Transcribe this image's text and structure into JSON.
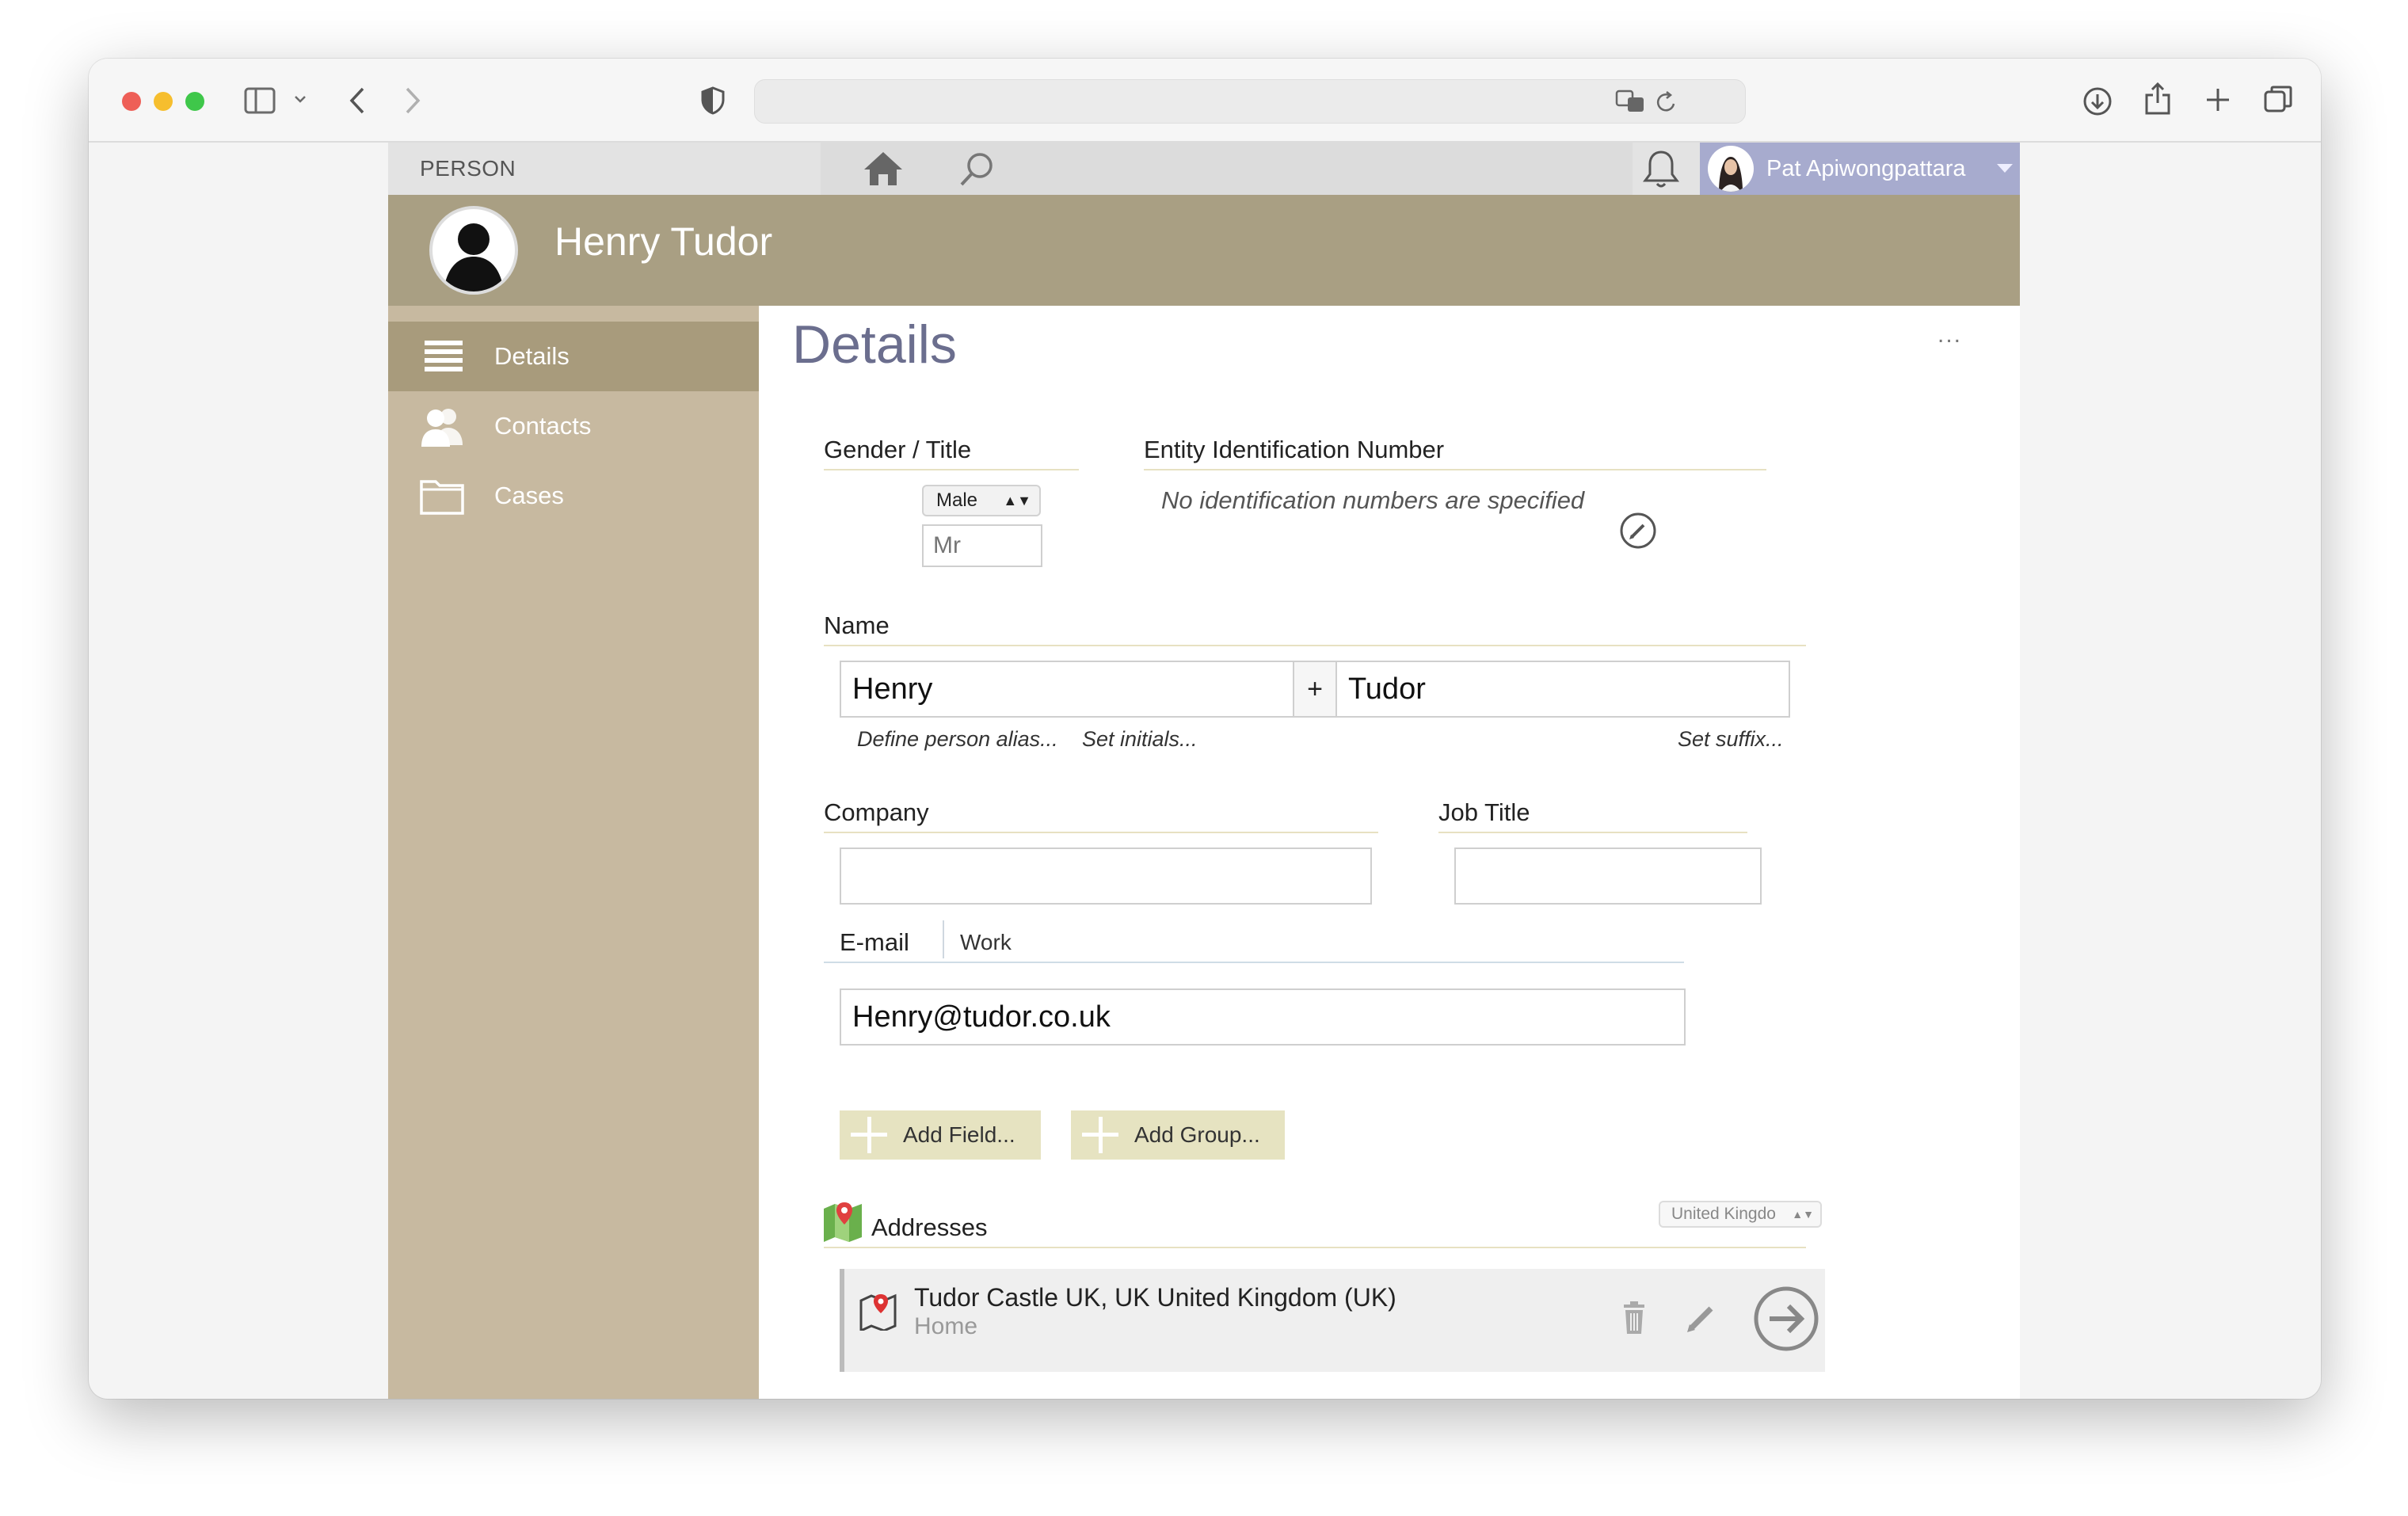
{
  "browser": {
    "traffic_lights": {
      "close": "#ee5f57",
      "minimize": "#f6be2e",
      "zoom": "#3fc74a"
    }
  },
  "topnav": {
    "module_label": "PERSON",
    "user_name": "Pat Apiwongpattara"
  },
  "header": {
    "person_name": "Henry Tudor"
  },
  "sidebar": {
    "items": [
      {
        "label": "Details",
        "icon": "list-icon",
        "active": true
      },
      {
        "label": "Contacts",
        "icon": "contacts-icon",
        "active": false
      },
      {
        "label": "Cases",
        "icon": "folder-icon",
        "active": false
      }
    ]
  },
  "details": {
    "title": "Details",
    "more": "...",
    "gender_title": {
      "label": "Gender / Title",
      "gender_value": "Male",
      "title_placeholder": "Mr"
    },
    "entity_id": {
      "label": "Entity Identification Number",
      "empty_text": "No identification numbers are specified"
    },
    "name": {
      "label": "Name",
      "first": "Henry",
      "plus": "+",
      "last": "Tudor",
      "alias_link": "Define person alias...",
      "initials_link": "Set initials...",
      "suffix_link": "Set suffix..."
    },
    "company": {
      "label": "Company",
      "value": ""
    },
    "job_title": {
      "label": "Job Title",
      "value": ""
    },
    "email": {
      "label": "E-mail",
      "type": "Work",
      "value": "Henry@tudor.co.uk"
    },
    "buttons": {
      "add_field": "Add Field...",
      "add_group": "Add Group..."
    },
    "addresses": {
      "label": "Addresses",
      "country_select": "United Kingdo",
      "items": [
        {
          "line": "Tudor Castle UK, UK United Kingdom (UK)",
          "type": "Home"
        }
      ]
    }
  },
  "colors": {
    "header_bg": "#a99f83",
    "sidebar_bg": "#c7b9a0",
    "sidebar_active": "#a89b7c",
    "user_area": "#a7abce",
    "title_color": "#6b6e8e",
    "button_bg": "#e6e3c1"
  }
}
